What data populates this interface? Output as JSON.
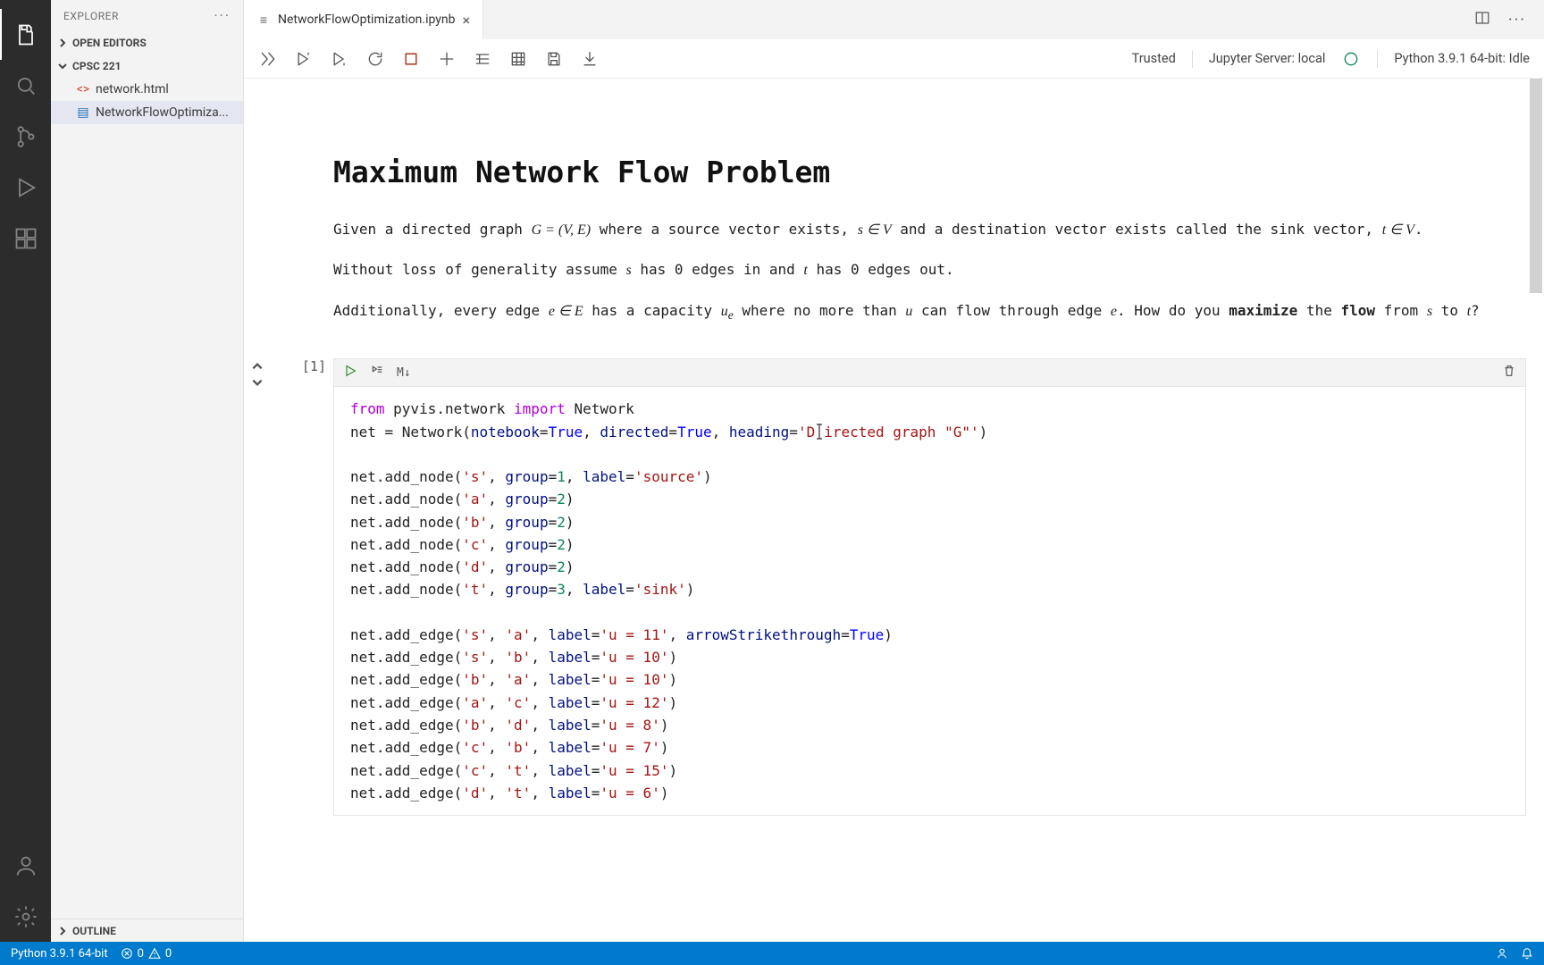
{
  "sidebar": {
    "title": "EXPLORER",
    "openEditors": "OPEN EDITORS",
    "workspace": "CPSC 221",
    "files": [
      {
        "name": "network.html",
        "kind": "html"
      },
      {
        "name": "NetworkFlowOptimiza...",
        "kind": "notebook"
      }
    ],
    "outline": "OUTLINE"
  },
  "tab": {
    "name": "NetworkFlowOptimization.ipynb"
  },
  "notebookToolbar": {
    "trusted": "Trusted",
    "server": "Jupyter Server: local",
    "kernel": "Python 3.9.1 64-bit: Idle"
  },
  "markdown": {
    "h1": "Maximum Network Flow Problem",
    "p1_a": "Given a directed graph ",
    "p1_math1": "G = (V, E)",
    "p1_b": " where a source vector exists, ",
    "p1_math2": "s ∈ V",
    "p1_c": " and a destination vector exists called the sink vector, ",
    "p1_math3": "t ∈ V",
    "p1_d": ".",
    "p2_a": "Without loss of generality assume ",
    "p2_s": "s",
    "p2_b": " has 0 edges in and ",
    "p2_t": "t",
    "p2_c": " has 0 edges out.",
    "p3_a": "Additionally, every edge ",
    "p3_math1": "e ∈ E",
    "p3_b": " has a capacity ",
    "p3_math2": "u",
    "p3_sub": "e",
    "p3_c": " where no more than ",
    "p3_math3": "u",
    "p3_d": " can flow through edge ",
    "p3_math4": "e",
    "p3_e": ". How do you ",
    "p3_strong": "maximize",
    "p3_f": " the ",
    "p3_strong2": "flow",
    "p3_g": " from ",
    "p3_s": "s",
    "p3_h": " to ",
    "p3_t": "t",
    "p3_i": "?"
  },
  "cell": {
    "execCount": "[1]",
    "mdLabel": "M↓"
  },
  "code": {
    "l1_kw1": "from",
    "l1_mod": " pyvis.network ",
    "l1_kw2": "import",
    "l1_cls": " Network",
    "l2_a": "net = Network(",
    "l2_p1": "notebook",
    "l2_eq": "=",
    "l2_true": "True",
    "l2_b": ", ",
    "l2_p2": "directed",
    "l2_c": ", ",
    "l2_p3": "heading",
    "l2_s1": "'Directed graph \"G\"'",
    "l2_end": ")",
    "l4": "net.add_node(",
    "l4_s": "'s'",
    "l4_c1": ", ",
    "l4_pg": "group",
    "l4_n1": "1",
    "l4_c2": ", ",
    "l4_pl": "label",
    "l4_sl": "'source'",
    "l4_end": ")",
    "l5": "net.add_node(",
    "l5_s": "'a'",
    "l5_c1": ", ",
    "l5_n": "2",
    "l5_end": ")",
    "l6": "net.add_node(",
    "l6_s": "'b'",
    "l6_end": ")",
    "l7": "net.add_node(",
    "l7_s": "'c'",
    "l7_end": ")",
    "l8": "net.add_node(",
    "l8_s": "'d'",
    "l8_end": ")",
    "l9": "net.add_node(",
    "l9_s": "'t'",
    "l9_n": "3",
    "l9_sl": "'sink'",
    "l9_end": ")",
    "e_pre": "net.add_edge(",
    "e1_a": "'s'",
    "e1_b": "'a'",
    "e1_lbl": "'u = 11'",
    "e1_pa": "arrowStrikethrough",
    "e2_a": "'s'",
    "e2_b": "'b'",
    "e2_lbl": "'u = 10'",
    "e3_a": "'b'",
    "e3_b": "'a'",
    "e3_lbl": "'u = 10'",
    "e4_a": "'a'",
    "e4_b": "'c'",
    "e4_lbl": "'u = 12'",
    "e5_a": "'b'",
    "e5_b": "'d'",
    "e5_lbl": "'u = 8'",
    "e6_a": "'c'",
    "e6_b": "'b'",
    "e6_lbl": "'u = 7'",
    "e7_a": "'c'",
    "e7_b": "'t'",
    "e7_lbl": "'u = 15'",
    "e8_a": "'d'",
    "e8_b": "'t'",
    "e8_lbl": "'u = 6'",
    "comma": ", ",
    "close": ")",
    "eq": "=",
    "p_label": "label",
    "p_group": "group"
  },
  "status": {
    "python": "Python 3.9.1 64-bit",
    "errors": "0",
    "warnings": "0"
  }
}
